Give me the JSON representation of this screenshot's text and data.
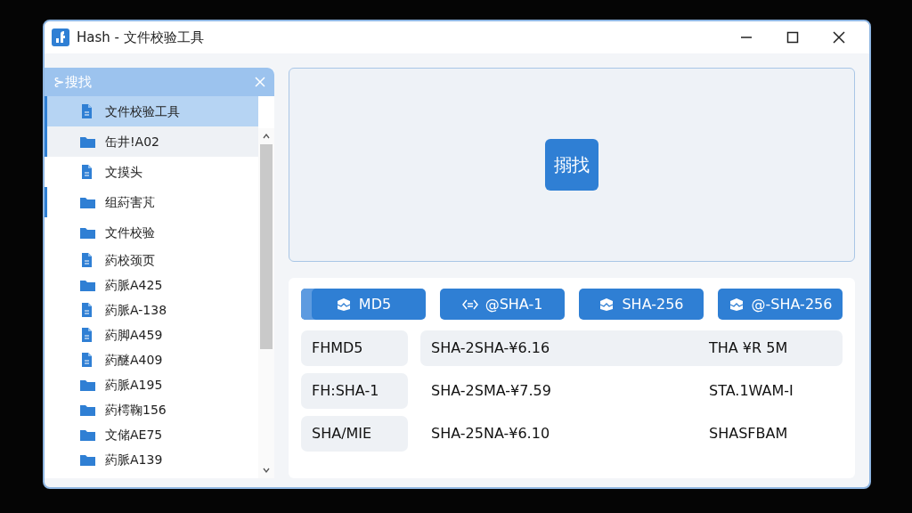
{
  "window": {
    "title": "Hash - 文件校验工具"
  },
  "sidebar": {
    "header": "⊱搜找",
    "items": [
      {
        "label": "文件校验工具",
        "kind": "file",
        "selected": true,
        "flagged": true,
        "hovered": false
      },
      {
        "label": "缶井!A02",
        "kind": "folder",
        "selected": false,
        "flagged": true,
        "hovered": true
      },
      {
        "label": "文摸头",
        "kind": "file",
        "selected": false,
        "flagged": false,
        "hovered": false
      },
      {
        "label": "组葤害芃",
        "kind": "folder",
        "selected": false,
        "flagged": true,
        "hovered": false
      },
      {
        "label": "文件校验",
        "kind": "folder",
        "selected": false,
        "flagged": false,
        "hovered": false
      },
      {
        "label": "葯校颈页",
        "kind": "file",
        "selected": false,
        "flagged": false,
        "hovered": false
      },
      {
        "label": "葯脈A425",
        "kind": "folder",
        "selected": false,
        "flagged": false,
        "hovered": false
      },
      {
        "label": "葯脈A-138",
        "kind": "file",
        "selected": false,
        "flagged": false,
        "hovered": false
      },
      {
        "label": "葯脚A459",
        "kind": "file",
        "selected": false,
        "flagged": false,
        "hovered": false
      },
      {
        "label": "葯醚A409",
        "kind": "file",
        "selected": false,
        "flagged": false,
        "hovered": false
      },
      {
        "label": "葯脈A195",
        "kind": "folder",
        "selected": false,
        "flagged": false,
        "hovered": false
      },
      {
        "label": "葯樗鞠156",
        "kind": "folder",
        "selected": false,
        "flagged": false,
        "hovered": false
      },
      {
        "label": "文储AE75",
        "kind": "folder",
        "selected": false,
        "flagged": false,
        "hovered": false
      },
      {
        "label": "葯脈A139",
        "kind": "folder",
        "selected": false,
        "flagged": false,
        "hovered": false
      }
    ]
  },
  "drop_area": {
    "button": "搦找"
  },
  "algorithms": [
    {
      "label": "MD5",
      "kind": "box",
      "selected": true
    },
    {
      "label": "@SHA-1",
      "kind": "code",
      "selected": false
    },
    {
      "label": "SHA-256",
      "kind": "box",
      "selected": false
    },
    {
      "label": "@-SHA-256",
      "kind": "box",
      "selected": false
    }
  ],
  "results": [
    {
      "label": "FHMD5",
      "value": "SHA-2SHA-¥6.16",
      "detail": "THA ¥R 5M",
      "highlighted": true
    },
    {
      "label": "FH:SHA-1",
      "value": "SHA-2SMA-¥7.59",
      "detail": "STA.1WAM-I",
      "highlighted": false
    },
    {
      "label": "SHA/MIE",
      "value": "SHA-25NA-¥6.10",
      "detail": "SHASFBAM",
      "highlighted": false
    }
  ]
}
